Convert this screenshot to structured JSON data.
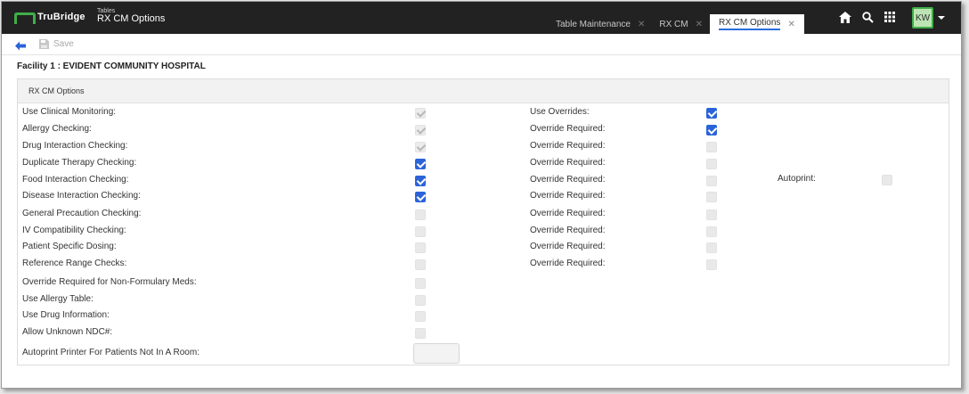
{
  "app": {
    "brand": "TruBridge",
    "section": "Tables",
    "page_title": "RX CM Options"
  },
  "tabs": [
    {
      "label": "Table Maintenance",
      "active": false
    },
    {
      "label": "RX CM",
      "active": false
    },
    {
      "label": "RX CM Options",
      "active": true
    }
  ],
  "header": {
    "user_initials": "KW",
    "icons": [
      "home-icon",
      "search-icon",
      "apps-grid-icon"
    ]
  },
  "toolbar": {
    "save_label": "Save"
  },
  "facility": "Facility 1 : EVIDENT COMMUNITY HOSPITAL",
  "panel": {
    "title": "RX CM Options",
    "left": [
      {
        "label": "Use Clinical Monitoring:",
        "state": "disabled-checked"
      },
      {
        "label": "Allergy Checking:",
        "state": "disabled-checked"
      },
      {
        "label": "Drug Interaction Checking:",
        "state": "disabled-checked"
      },
      {
        "label": "Duplicate Therapy Checking:",
        "state": "checked"
      },
      {
        "label": "Food Interaction Checking:",
        "state": "checked"
      },
      {
        "label": "Disease Interaction Checking:",
        "state": "checked"
      },
      {
        "label": "General Precaution Checking:",
        "state": "disabled"
      },
      {
        "label": "IV Compatibility Checking:",
        "state": "disabled"
      },
      {
        "label": "Patient Specific Dosing:",
        "state": "disabled"
      },
      {
        "label": "Reference Range Checks:",
        "state": "disabled"
      },
      {
        "label": "Override Required for Non-Formulary Meds:",
        "state": "disabled"
      },
      {
        "label": "Use Allergy Table:",
        "state": "disabled"
      },
      {
        "label": "Use Drug Information:",
        "state": "disabled"
      },
      {
        "label": "Allow Unknown NDC#:",
        "state": "disabled"
      }
    ],
    "right": [
      {
        "label": "Use Overrides:",
        "state": "checked"
      },
      {
        "label": "Override Required:",
        "state": "checked"
      },
      {
        "label": "Override Required:",
        "state": "disabled"
      },
      {
        "label": "Override Required:",
        "state": "disabled"
      },
      {
        "label": "Override Required:",
        "state": "disabled"
      },
      {
        "label": "Override Required:",
        "state": "disabled"
      },
      {
        "label": "Override Required:",
        "state": "disabled"
      },
      {
        "label": "Override Required:",
        "state": "disabled"
      },
      {
        "label": "Override Required:",
        "state": "disabled"
      },
      {
        "label": "Override Required:",
        "state": "disabled"
      }
    ],
    "autoprint": {
      "label": "Autoprint:",
      "state": "disabled"
    },
    "autoprint_printer": {
      "label": "Autoprint Printer For Patients Not In A Room:",
      "value": ""
    }
  },
  "colors": {
    "header_bg": "#222222",
    "accent_green": "#3fae49",
    "checkbox_blue": "#2b63d9",
    "active_tab_underline": "#2a6fdb"
  }
}
